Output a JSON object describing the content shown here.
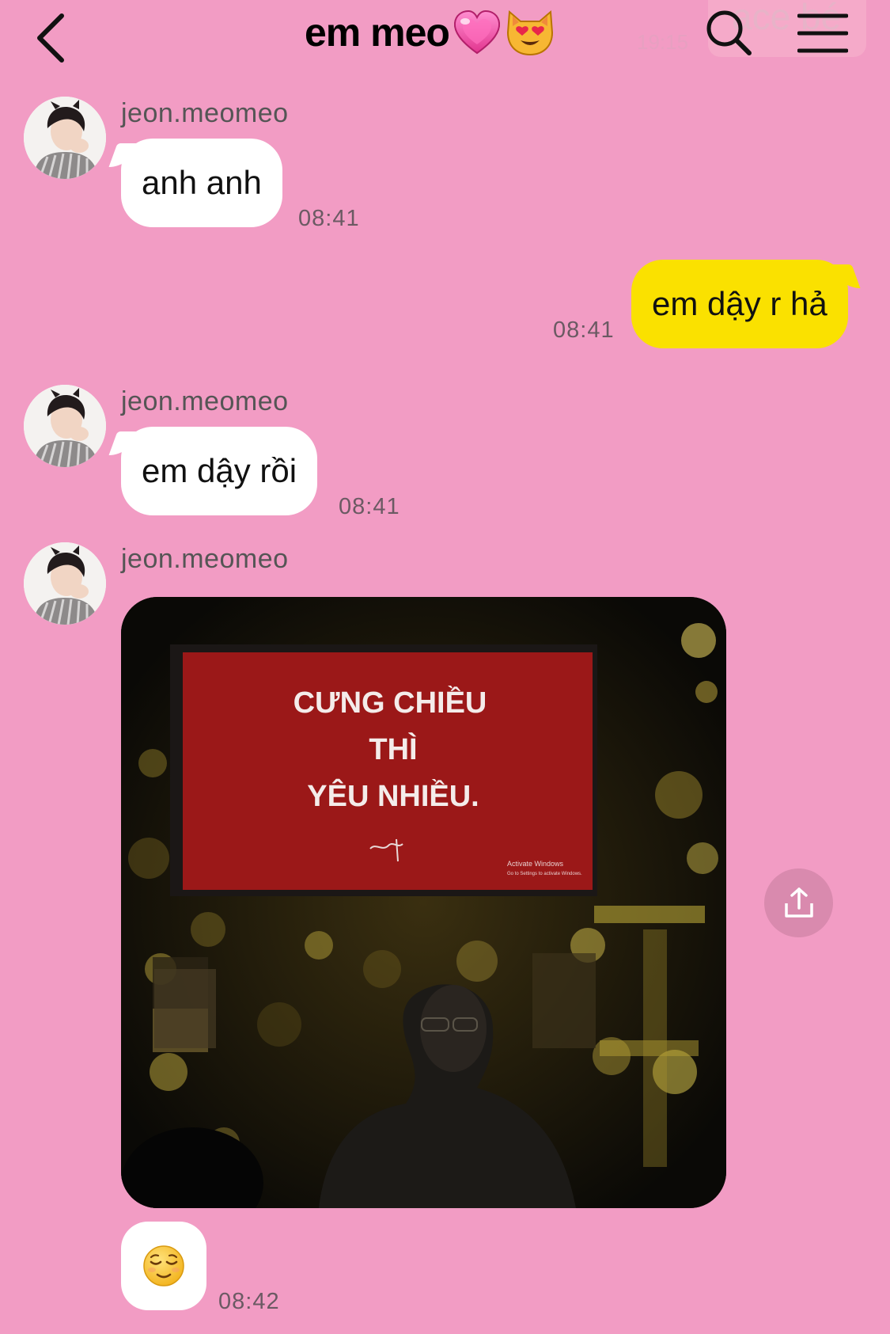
{
  "header": {
    "title": "em meo",
    "title_emojis": [
      "heart-icon",
      "heart-eyes-cat-icon"
    ],
    "ghost_time": "19:15",
    "ghost_text": "ace bé"
  },
  "messages": [
    {
      "sender": "jeon.meomeo",
      "text": "anh anh",
      "time": "08:41",
      "mine": false
    },
    {
      "text": "em dậy r hả",
      "time": "08:41",
      "mine": true
    },
    {
      "sender": "jeon.meomeo",
      "text": "em dậy rồi",
      "time": "08:41",
      "mine": false
    },
    {
      "sender": "jeon.meomeo",
      "type": "photo",
      "photo": {
        "sign_lines": [
          "CƯNG CHIỀU",
          "THÌ",
          "YÊU NHIỀU."
        ],
        "watermark_title": "Activate Windows",
        "watermark_sub": "Go to Settings to activate Windows."
      },
      "sticker": "relieved-face-icon",
      "time": "08:42"
    }
  ],
  "colors": {
    "background": "#f29cc4",
    "my_bubble": "#fae100",
    "their_bubble": "#ffffff",
    "share_button": "#d98aae",
    "sign_red": "#8e1414"
  }
}
